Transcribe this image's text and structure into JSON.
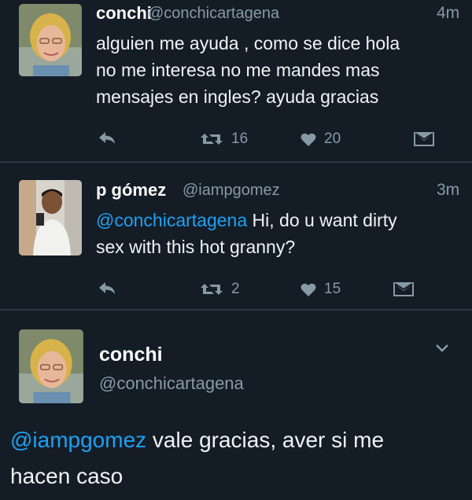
{
  "tweets": [
    {
      "name": "conchi",
      "handle": "@conchicartagena",
      "time": "4m",
      "lines": [
        "alguien me ayuda , como se dice hola",
        "no me interesa no me mandes mas",
        "mensajes en ingles? ayuda gracias"
      ],
      "retweets": "16",
      "likes": "20"
    },
    {
      "name": "p gómez",
      "handle": "@iampgomez",
      "time": "3m",
      "mention": "@conchicartagena",
      "line1_rest": " Hi, do u want dirty",
      "line2": "sex with this hot granny?",
      "retweets": "2",
      "likes": "15"
    },
    {
      "name": "conchi",
      "handle": "@conchicartagena",
      "mention": "@iampgomez",
      "line1_rest": " vale gracias, aver si me",
      "line2": "hacen caso"
    }
  ],
  "icons": {
    "reply": "reply-icon",
    "retweet": "retweet-icon",
    "like": "heart-icon",
    "dm": "envelope-icon",
    "more": "chevron-down-icon"
  },
  "colors": {
    "background": "#141d26",
    "mention": "#1da1f2",
    "muted": "#8899a6"
  }
}
